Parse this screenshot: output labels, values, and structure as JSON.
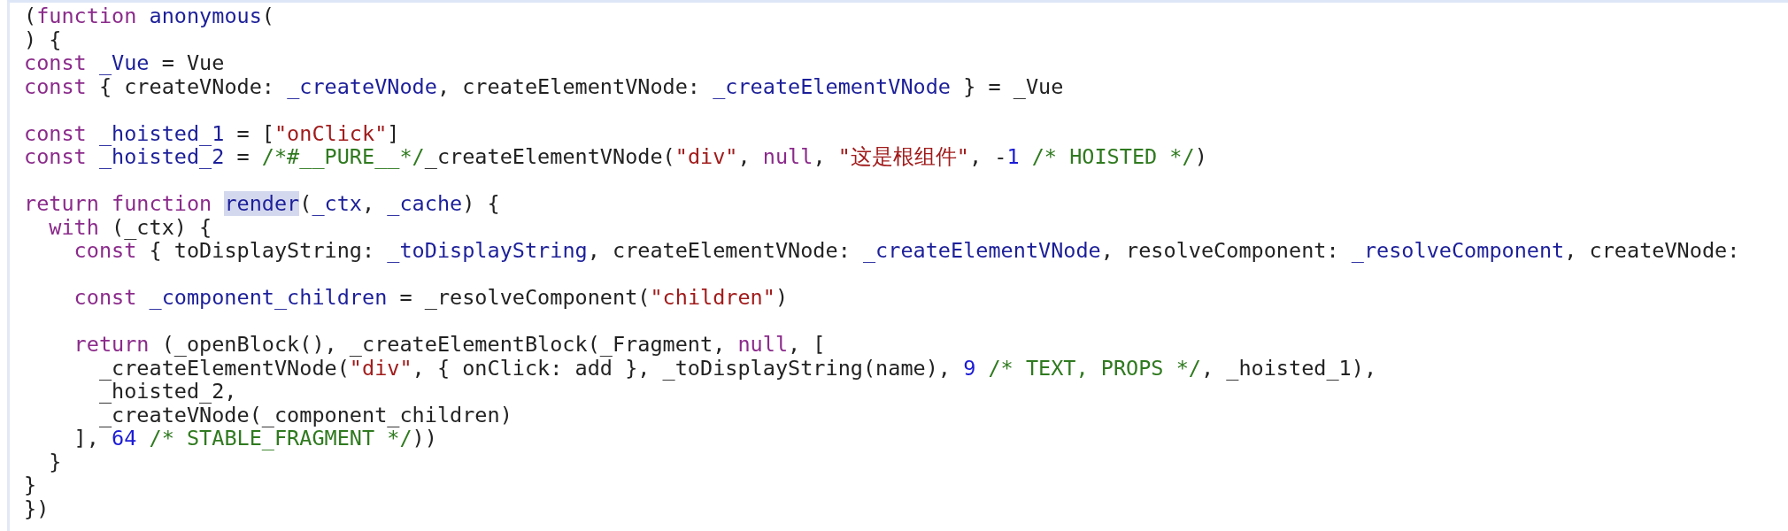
{
  "code_blocks": [
    {
      "lines": [
        {
          "tokens": [
            {
              "kind": "plain",
              "text": "("
            },
            {
              "kind": "keyword",
              "text": "function "
            },
            {
              "kind": "name",
              "text": "anonymous"
            },
            {
              "kind": "plain",
              "text": "("
            }
          ]
        },
        {
          "tokens": [
            {
              "kind": "plain",
              "text": ") {"
            }
          ]
        },
        {
          "tokens": [
            {
              "kind": "keyword",
              "text": "const "
            },
            {
              "kind": "name",
              "text": "_Vue"
            },
            {
              "kind": "plain",
              "text": " = Vue"
            }
          ]
        },
        {
          "tokens": [
            {
              "kind": "keyword",
              "text": "const"
            },
            {
              "kind": "plain",
              "text": " { createVNode: "
            },
            {
              "kind": "name",
              "text": "_createVNode"
            },
            {
              "kind": "plain",
              "text": ", createElementVNode: "
            },
            {
              "kind": "name",
              "text": "_createElementVNode"
            },
            {
              "kind": "plain",
              "text": " } = _Vue"
            }
          ]
        }
      ]
    },
    {
      "lines": [
        {
          "tokens": [
            {
              "kind": "keyword",
              "text": "const "
            },
            {
              "kind": "name",
              "text": "_hoisted_1"
            },
            {
              "kind": "plain",
              "text": " = ["
            },
            {
              "kind": "string",
              "text": "\"onClick\""
            },
            {
              "kind": "plain",
              "text": "]"
            }
          ]
        },
        {
          "tokens": [
            {
              "kind": "keyword",
              "text": "const "
            },
            {
              "kind": "name",
              "text": "_hoisted_2"
            },
            {
              "kind": "plain",
              "text": " = "
            },
            {
              "kind": "comment",
              "text": "/*#__PURE__*/"
            },
            {
              "kind": "plain",
              "text": "_createElementVNode("
            },
            {
              "kind": "string",
              "text": "\"div\""
            },
            {
              "kind": "plain",
              "text": ", "
            },
            {
              "kind": "keyword",
              "text": "null"
            },
            {
              "kind": "plain",
              "text": ", "
            },
            {
              "kind": "string",
              "text": "\"这是根组件\""
            },
            {
              "kind": "plain",
              "text": ", -"
            },
            {
              "kind": "number",
              "text": "1"
            },
            {
              "kind": "comment",
              "text": " /* HOISTED */"
            },
            {
              "kind": "plain",
              "text": ")"
            }
          ]
        }
      ]
    },
    {
      "lines": [
        {
          "tokens": [
            {
              "kind": "keyword",
              "text": "return function "
            },
            {
              "kind": "match",
              "text": "render"
            },
            {
              "kind": "plain",
              "text": "("
            },
            {
              "kind": "name",
              "text": "_ctx"
            },
            {
              "kind": "plain",
              "text": ", "
            },
            {
              "kind": "name",
              "text": "_cache"
            },
            {
              "kind": "plain",
              "text": ") {"
            }
          ]
        },
        {
          "tokens": [
            {
              "kind": "keyword",
              "text": "  with"
            },
            {
              "kind": "plain",
              "text": " (_ctx) {"
            }
          ]
        },
        {
          "tokens": [
            {
              "kind": "keyword",
              "text": "    const"
            },
            {
              "kind": "plain",
              "text": " { toDisplayString: "
            },
            {
              "kind": "name",
              "text": "_toDisplayString"
            },
            {
              "kind": "plain",
              "text": ", createElementVNode: "
            },
            {
              "kind": "name",
              "text": "_createElementVNode"
            },
            {
              "kind": "plain",
              "text": ", resolveComponent: "
            },
            {
              "kind": "name",
              "text": "_resolveComponent"
            },
            {
              "kind": "plain",
              "text": ", createVNode:"
            }
          ]
        }
      ]
    },
    {
      "lines": [
        {
          "tokens": [
            {
              "kind": "keyword",
              "text": "    const "
            },
            {
              "kind": "name",
              "text": "_component_children"
            },
            {
              "kind": "plain",
              "text": " = _resolveComponent("
            },
            {
              "kind": "string",
              "text": "\"children\""
            },
            {
              "kind": "plain",
              "text": ")"
            }
          ]
        }
      ]
    },
    {
      "lines": [
        {
          "tokens": [
            {
              "kind": "keyword",
              "text": "    return"
            },
            {
              "kind": "plain",
              "text": " (_openBlock(), _createElementBlock(_Fragment, "
            },
            {
              "kind": "keyword",
              "text": "null"
            },
            {
              "kind": "plain",
              "text": ", ["
            }
          ]
        },
        {
          "tokens": [
            {
              "kind": "plain",
              "text": "      _createElementVNode("
            },
            {
              "kind": "string",
              "text": "\"div\""
            },
            {
              "kind": "plain",
              "text": ", { onClick: add }, _toDisplayString(name), "
            },
            {
              "kind": "number",
              "text": "9"
            },
            {
              "kind": "comment",
              "text": " /* TEXT, PROPS */"
            },
            {
              "kind": "plain",
              "text": ", _hoisted_1),"
            }
          ]
        },
        {
          "tokens": [
            {
              "kind": "plain",
              "text": "      _hoisted_2,"
            }
          ]
        },
        {
          "tokens": [
            {
              "kind": "plain",
              "text": "      _createVNode(_component_children)"
            }
          ]
        },
        {
          "tokens": [
            {
              "kind": "plain",
              "text": "    ], "
            },
            {
              "kind": "number",
              "text": "64"
            },
            {
              "kind": "comment",
              "text": " /* STABLE_FRAGMENT */"
            },
            {
              "kind": "plain",
              "text": "))"
            }
          ]
        },
        {
          "tokens": [
            {
              "kind": "plain",
              "text": "  }"
            }
          ]
        },
        {
          "tokens": [
            {
              "kind": "plain",
              "text": "}"
            }
          ]
        },
        {
          "tokens": [
            {
              "kind": "plain",
              "text": "})"
            }
          ]
        }
      ]
    }
  ]
}
